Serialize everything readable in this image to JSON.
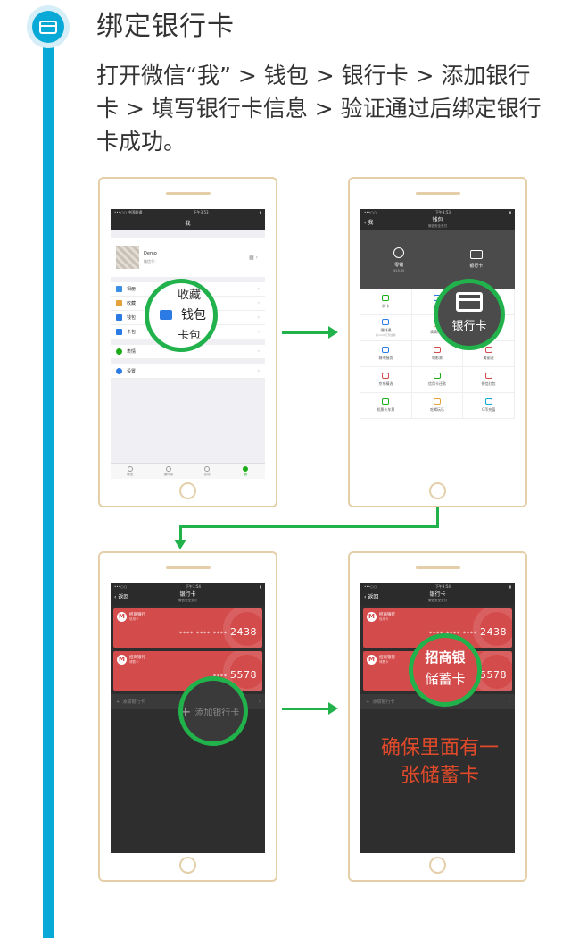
{
  "step": {
    "title": "绑定银行卡",
    "description": "打开微信“我” > 钱包 > 银行卡 > 添加银行卡 > 填写银行卡信息 > 验证通过后绑定银行卡成功。"
  },
  "phone1": {
    "status": "•••○○ 中国联通",
    "time": "下午3:53",
    "nav_title": "我",
    "profile_name": "Demo",
    "profile_wx": "微信号：",
    "menu": [
      {
        "label": "相册",
        "color": "#3a8ee6"
      },
      {
        "label": "收藏",
        "color": "#e6a23a"
      },
      {
        "label": "钱包",
        "color": "#2c7be5"
      },
      {
        "label": "卡包",
        "color": "#2c7be5"
      }
    ],
    "emoji_label": "表情",
    "settings_label": "设置",
    "tabs": [
      "微信",
      "通讯录",
      "发现",
      "我"
    ],
    "magnifier": {
      "top": "收藏",
      "main": "钱包",
      "bottom": "卡包"
    }
  },
  "phone2": {
    "time": "下午3:53",
    "back": "我",
    "nav_title": "钱包",
    "nav_sub": "微信安全支付",
    "top_items": [
      {
        "label": "零钱",
        "amount": "¥15.30"
      },
      {
        "label": "银行卡",
        "amount": ""
      }
    ],
    "grid": [
      {
        "label": "刷卡",
        "sub": "",
        "color": "#1aad19"
      },
      {
        "label": "转账",
        "sub": "",
        "color": "#2c7be5"
      },
      {
        "label": "手机充值",
        "sub": "",
        "color": "#2c7be5"
      },
      {
        "label": "理财通",
        "sub": "赢1000元现金券",
        "color": "#2c7be5"
      },
      {
        "label": "滴滴打车",
        "sub": "",
        "color": "#e6a23a"
      },
      {
        "label": "生活缴费",
        "sub": "",
        "color": "#1aad19"
      },
      {
        "label": "城市服务",
        "sub": "",
        "color": "#2c7be5"
      },
      {
        "label": "电影票",
        "sub": "",
        "color": "#d44b4b"
      },
      {
        "label": "美丽说",
        "sub": "",
        "color": "#d44b4b"
      },
      {
        "label": "京东精选",
        "sub": "",
        "color": "#d44b4b"
      },
      {
        "label": "信用卡还款",
        "sub": "",
        "color": "#1aad19"
      },
      {
        "label": "微信红包",
        "sub": "",
        "color": "#d44b4b"
      },
      {
        "label": "机票火车票",
        "sub": "",
        "color": "#1aad19"
      },
      {
        "label": "吃喝玩乐",
        "sub": "",
        "color": "#e6a23a"
      },
      {
        "label": "Q币充值",
        "sub": "",
        "color": "#08a9d6"
      }
    ],
    "magnifier": "银行卡"
  },
  "phone3": {
    "time": "下午3:54",
    "back": "返回",
    "nav_title": "银行卡",
    "nav_sub": "微信安全支付",
    "cards": [
      {
        "bank": "招商银行",
        "type": "信用卡",
        "dots": "**** **** ****",
        "last4": "2438"
      },
      {
        "bank": "招商银行",
        "type": "储蓄卡",
        "dots": "****",
        "last4": "5578"
      }
    ],
    "add_label": "添加银行卡",
    "magnifier": "添加银行卡"
  },
  "phone4": {
    "magnifier_top": "招商银",
    "magnifier_main": "储蓄卡",
    "note": "确保里面有一张储蓄卡"
  }
}
